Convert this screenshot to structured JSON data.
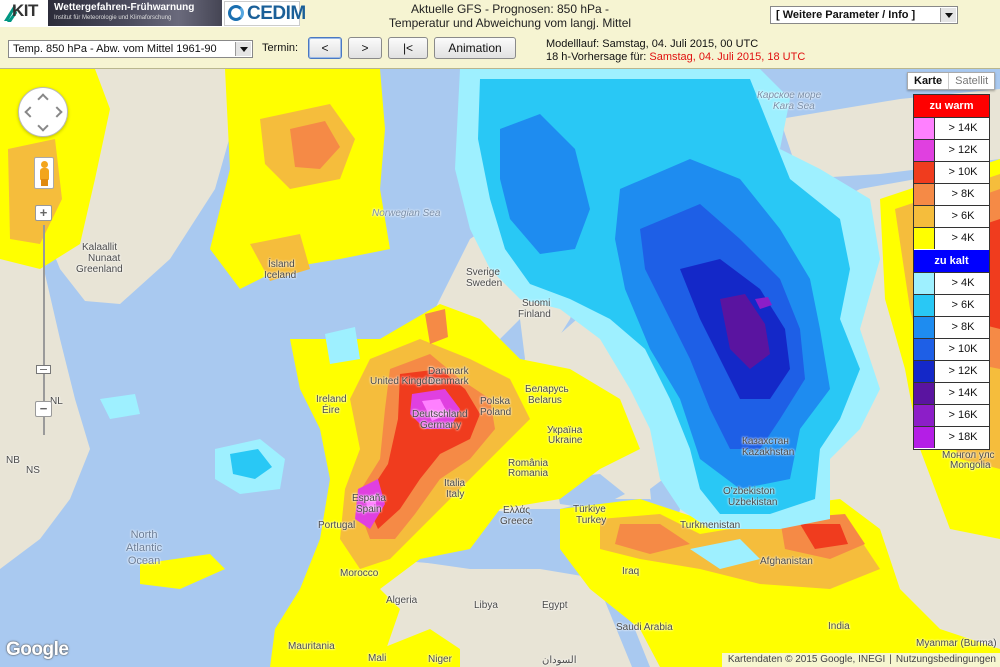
{
  "header": {
    "logos": {
      "kit": "KIT",
      "banner_title": "Wettergefahren-Frühwarnung",
      "banner_subtitle": "Institut für Meteorologie und Klimaforschung",
      "cedim": "CEDIM"
    },
    "title_line1": "Aktuelle GFS - Prognosen: 850 hPa -",
    "title_line2": "Temperatur und Abweichung vom langj. Mittel",
    "more_params": "[ Weitere Parameter / Info ]",
    "parameter_select": "Temp. 850 hPa - Abw. vom Mittel 1961-90",
    "termin_label": "Termin:",
    "buttons": {
      "prev": "<",
      "next": ">",
      "first": "|<",
      "animation": "Animation"
    },
    "model_run_label": "Modelllauf:",
    "model_run_value": "Samstag, 04. Juli 2015, 00 UTC",
    "forecast_label": "18 h-Vorhersage für:",
    "forecast_value": "Samstag, 04. Juli 2015, 18 UTC"
  },
  "map_controls": {
    "zoom_in": "+",
    "zoom_out": "−",
    "map_type": {
      "map": "Karte",
      "satellite": "Satellit",
      "selected": "Karte"
    },
    "google": "Google",
    "attribution": "Kartendaten © 2015 Google, INEGI",
    "terms": "Nutzungsbedingungen"
  },
  "legend": {
    "warm_title": "zu warm",
    "warm_color": "#ff0000",
    "warm": [
      {
        "label": "> 14K",
        "color": "#ff80ff"
      },
      {
        "label": "> 12K",
        "color": "#e040e0"
      },
      {
        "label": "> 10K",
        "color": "#f03c1e"
      },
      {
        "label": "> 8K",
        "color": "#f58a46"
      },
      {
        "label": "> 6K",
        "color": "#f5bd3c"
      },
      {
        "label": "> 4K",
        "color": "#ffff00"
      }
    ],
    "cold_title": "zu kalt",
    "cold_color": "#0000ff",
    "cold": [
      {
        "label": "> 4K",
        "color": "#9ef0ff"
      },
      {
        "label": "> 6K",
        "color": "#29c8f5"
      },
      {
        "label": "> 8K",
        "color": "#1e8cf0"
      },
      {
        "label": "> 10K",
        "color": "#1e5fe6"
      },
      {
        "label": "> 12K",
        "color": "#1428c8"
      },
      {
        "label": "> 14K",
        "color": "#5a14a0"
      },
      {
        "label": "> 16K",
        "color": "#8c1ec8"
      },
      {
        "label": "> 18K",
        "color": "#b41ee6"
      }
    ]
  },
  "map_labels": {
    "kalaallit": "Kalaallit",
    "nunaat": "Nunaat",
    "greenland": "Greenland",
    "island": "Ísland",
    "iceland": "Iceland",
    "norwegian_sea": "Norwegian Sea",
    "sverige": "Sverige",
    "sweden": "Sweden",
    "suomi": "Suomi",
    "finland": "Finland",
    "kara_ru": "Карское море",
    "kara_sea": "Kara Sea",
    "united_kingdom": "United Kingdom",
    "ireland": "Ireland",
    "eire": "Éire",
    "danmark": "Danmark",
    "denmark": "Denmark",
    "deutschland": "Deutschland",
    "germany": "Germany",
    "polska": "Polska",
    "poland": "Poland",
    "belarus_ru": "Беларусь",
    "belarus": "Belarus",
    "ukraina_ru": "Україна",
    "ukraine": "Ukraine",
    "romania": "România",
    "romania_en": "Romania",
    "italia": "Italia",
    "italy": "Italy",
    "espana": "España",
    "spain": "Spain",
    "portugal": "Portugal",
    "hellas": "Ελλάς",
    "greece": "Greece",
    "turkiye": "Türkiye",
    "turkey": "Turkey",
    "iraq": "Iraq",
    "kazakhstan_ru": "Казахстан",
    "kazakhstan": "Kazakhstan",
    "uzbekistan": "O'zbekiston",
    "uzbekistan_en": "Uzbekistan",
    "turkmenistan": "Turkmenistan",
    "afghanistan": "Afghanistan",
    "mongolia_ru": "Монгол улс",
    "mongolia": "Mongolia",
    "north": "North",
    "atlantic": "Atlantic",
    "ocean": "Ocean",
    "morocco": "Morocco",
    "algeria": "Algeria",
    "libya": "Libya",
    "egypt": "Egypt",
    "saudi_arabia": "Saudi Arabia",
    "mali": "Mali",
    "niger": "Niger",
    "sudan": "السودان",
    "india": "India",
    "myanmar": "Myanmar (Burma)",
    "nl": "NL",
    "nb": "NB",
    "ns": "NS",
    "mauritania": "Mauritania"
  }
}
